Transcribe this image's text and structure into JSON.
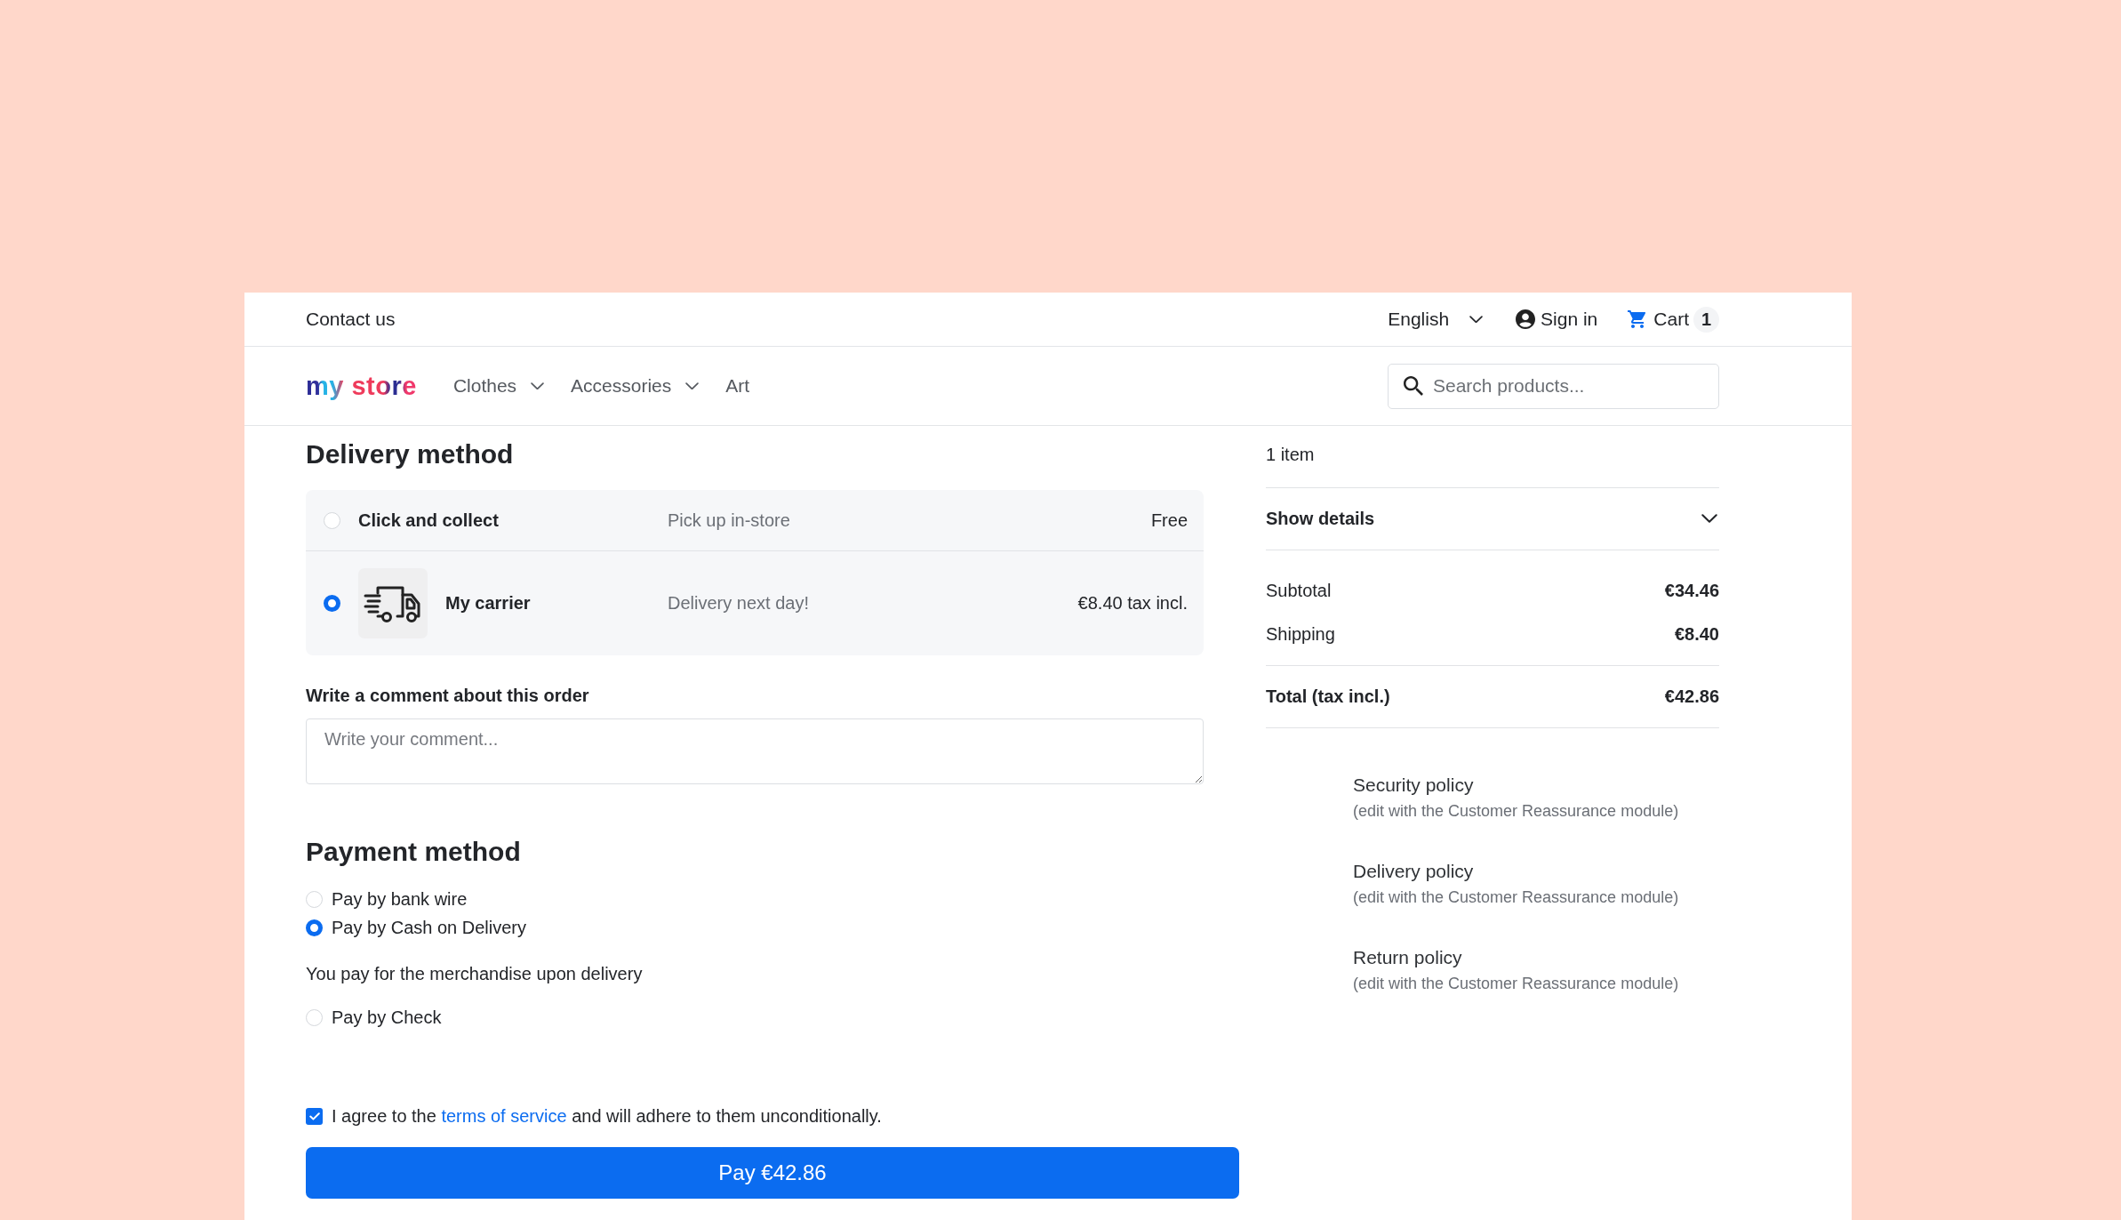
{
  "top_bar": {
    "contact_link": "Contact us",
    "language": "English",
    "sign_in": "Sign in",
    "cart": {
      "label": "Cart",
      "count": "1"
    }
  },
  "nav": {
    "logo": "my store",
    "menu": [
      {
        "label": "Clothes",
        "has_submenu": true
      },
      {
        "label": "Accessories",
        "has_submenu": true
      },
      {
        "label": "Art",
        "has_submenu": false
      }
    ],
    "search": {
      "placeholder": "Search products..."
    }
  },
  "delivery": {
    "title": "Delivery method",
    "options": [
      {
        "name": "Click and collect",
        "description": "Pick up in-store",
        "price": "Free",
        "selected": false,
        "has_logo": false
      },
      {
        "name": "My carrier",
        "description": "Delivery next day!",
        "price": "€8.40 tax incl.",
        "selected": true,
        "has_logo": true
      }
    ],
    "comment": {
      "label": "Write a comment about this order",
      "placeholder": "Write your comment..."
    }
  },
  "payment": {
    "title": "Payment method",
    "options": [
      {
        "label": "Pay by bank wire",
        "selected": false
      },
      {
        "label": "Pay by Cash on Delivery",
        "selected": true,
        "note": "You pay for the merchandise upon delivery"
      },
      {
        "label": "Pay by Check",
        "selected": false
      }
    ]
  },
  "terms": {
    "checked": true,
    "text_before": "I agree to the",
    "link": "terms of service",
    "text_after": "and will adhere to them unconditionally."
  },
  "pay_button": "Pay €42.86",
  "summary": {
    "item_count": "1 item",
    "details": {
      "label": "Show details",
      "expanded": false
    },
    "lines": [
      {
        "label": "Subtotal",
        "value": "€34.46"
      },
      {
        "label": "Shipping",
        "value": "€8.40"
      }
    ],
    "total": {
      "label": "Total (tax incl.)",
      "value": "€42.86"
    }
  },
  "reassurance": [
    {
      "title": "Security policy",
      "note": "(edit with the Customer Reassurance module)"
    },
    {
      "title": "Delivery policy",
      "note": "(edit with the Customer Reassurance module)"
    },
    {
      "title": "Return policy",
      "note": "(edit with the Customer Reassurance module)"
    }
  ]
}
